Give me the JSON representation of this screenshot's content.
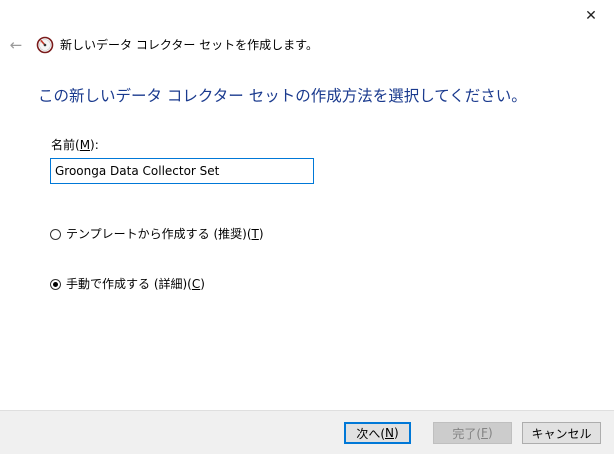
{
  "window": {
    "close_glyph": "✕",
    "back_glyph": "←",
    "title": "新しいデータ コレクター セットを作成します。"
  },
  "main": {
    "instruction": "この新しいデータ コレクター セットの作成方法を選択してください。",
    "name_label_prefix": "名前(",
    "name_label_key": "M",
    "name_label_suffix": "):",
    "name_value": "Groonga Data Collector Set",
    "options": [
      {
        "label_prefix": "テンプレートから作成する (推奨)(",
        "key": "T",
        "label_suffix": ")",
        "selected": false
      },
      {
        "label_prefix": "手動で作成する (詳細)(",
        "key": "C",
        "label_suffix": ")",
        "selected": true
      }
    ]
  },
  "footer": {
    "next": {
      "prefix": "次へ(",
      "key": "N",
      "suffix": ")"
    },
    "finish": {
      "prefix": "完了(",
      "key": "F",
      "suffix": ")"
    },
    "cancel": "キャンセル"
  },
  "colors": {
    "instruction": "#1a3a8e",
    "accent": "#0078d7",
    "footer_bg": "#f0f0f0"
  }
}
